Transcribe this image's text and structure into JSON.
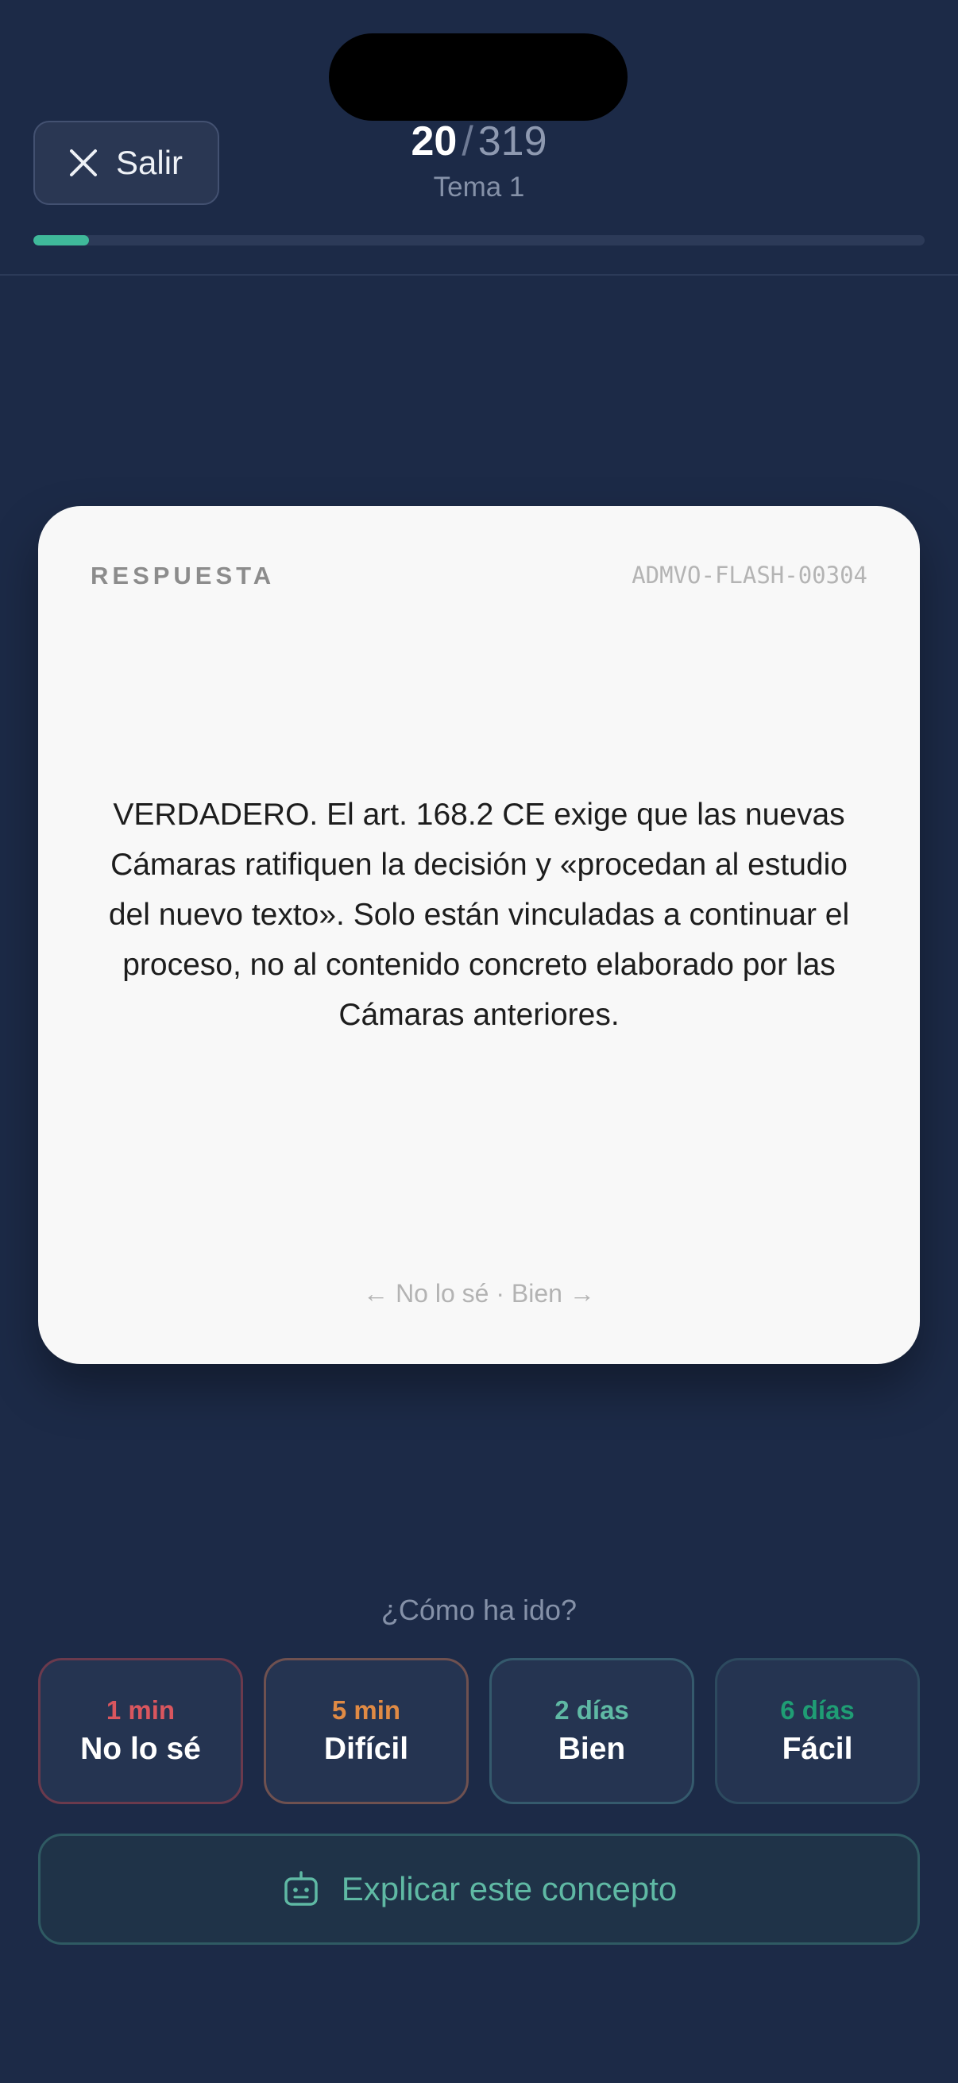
{
  "header": {
    "exit_label": "Salir",
    "current": "20",
    "separator": "/",
    "total": "319",
    "topic": "Tema 1",
    "progress_fraction": 0.0627
  },
  "card": {
    "label": "RESPUESTA",
    "id": "ADMVO-FLASH-00304",
    "text": "VERDADERO. El art. 168.2 CE exige que las nuevas Cámaras ratifiquen la decisión y «procedan al estudio del nuevo texto». Solo están vinculadas a continuar el proceso, no al contenido concreto elaborado por las Cámaras anteriores.",
    "hint": "← No lo sé · Bien →"
  },
  "rating": {
    "prompt": "¿Cómo ha ido?",
    "options": [
      {
        "interval": "1 min",
        "label": "No lo sé",
        "color": "#d9565e",
        "border": "#6b3a4d"
      },
      {
        "interval": "5 min",
        "label": "Difícil",
        "color": "#e08a44",
        "border": "#6f5150"
      },
      {
        "interval": "2 días",
        "label": "Bien",
        "color": "#5fb9a4",
        "border": "#355a6d"
      },
      {
        "interval": "6 días",
        "label": "Fácil",
        "color": "#1f9d74",
        "border": "#2d4a5f"
      }
    ]
  },
  "explain": {
    "label": "Explicar este concepto",
    "icon": "robot-icon"
  },
  "colors": {
    "background": "#1c2a47",
    "accent": "#3fb99a",
    "card": "#f8f8f8"
  }
}
